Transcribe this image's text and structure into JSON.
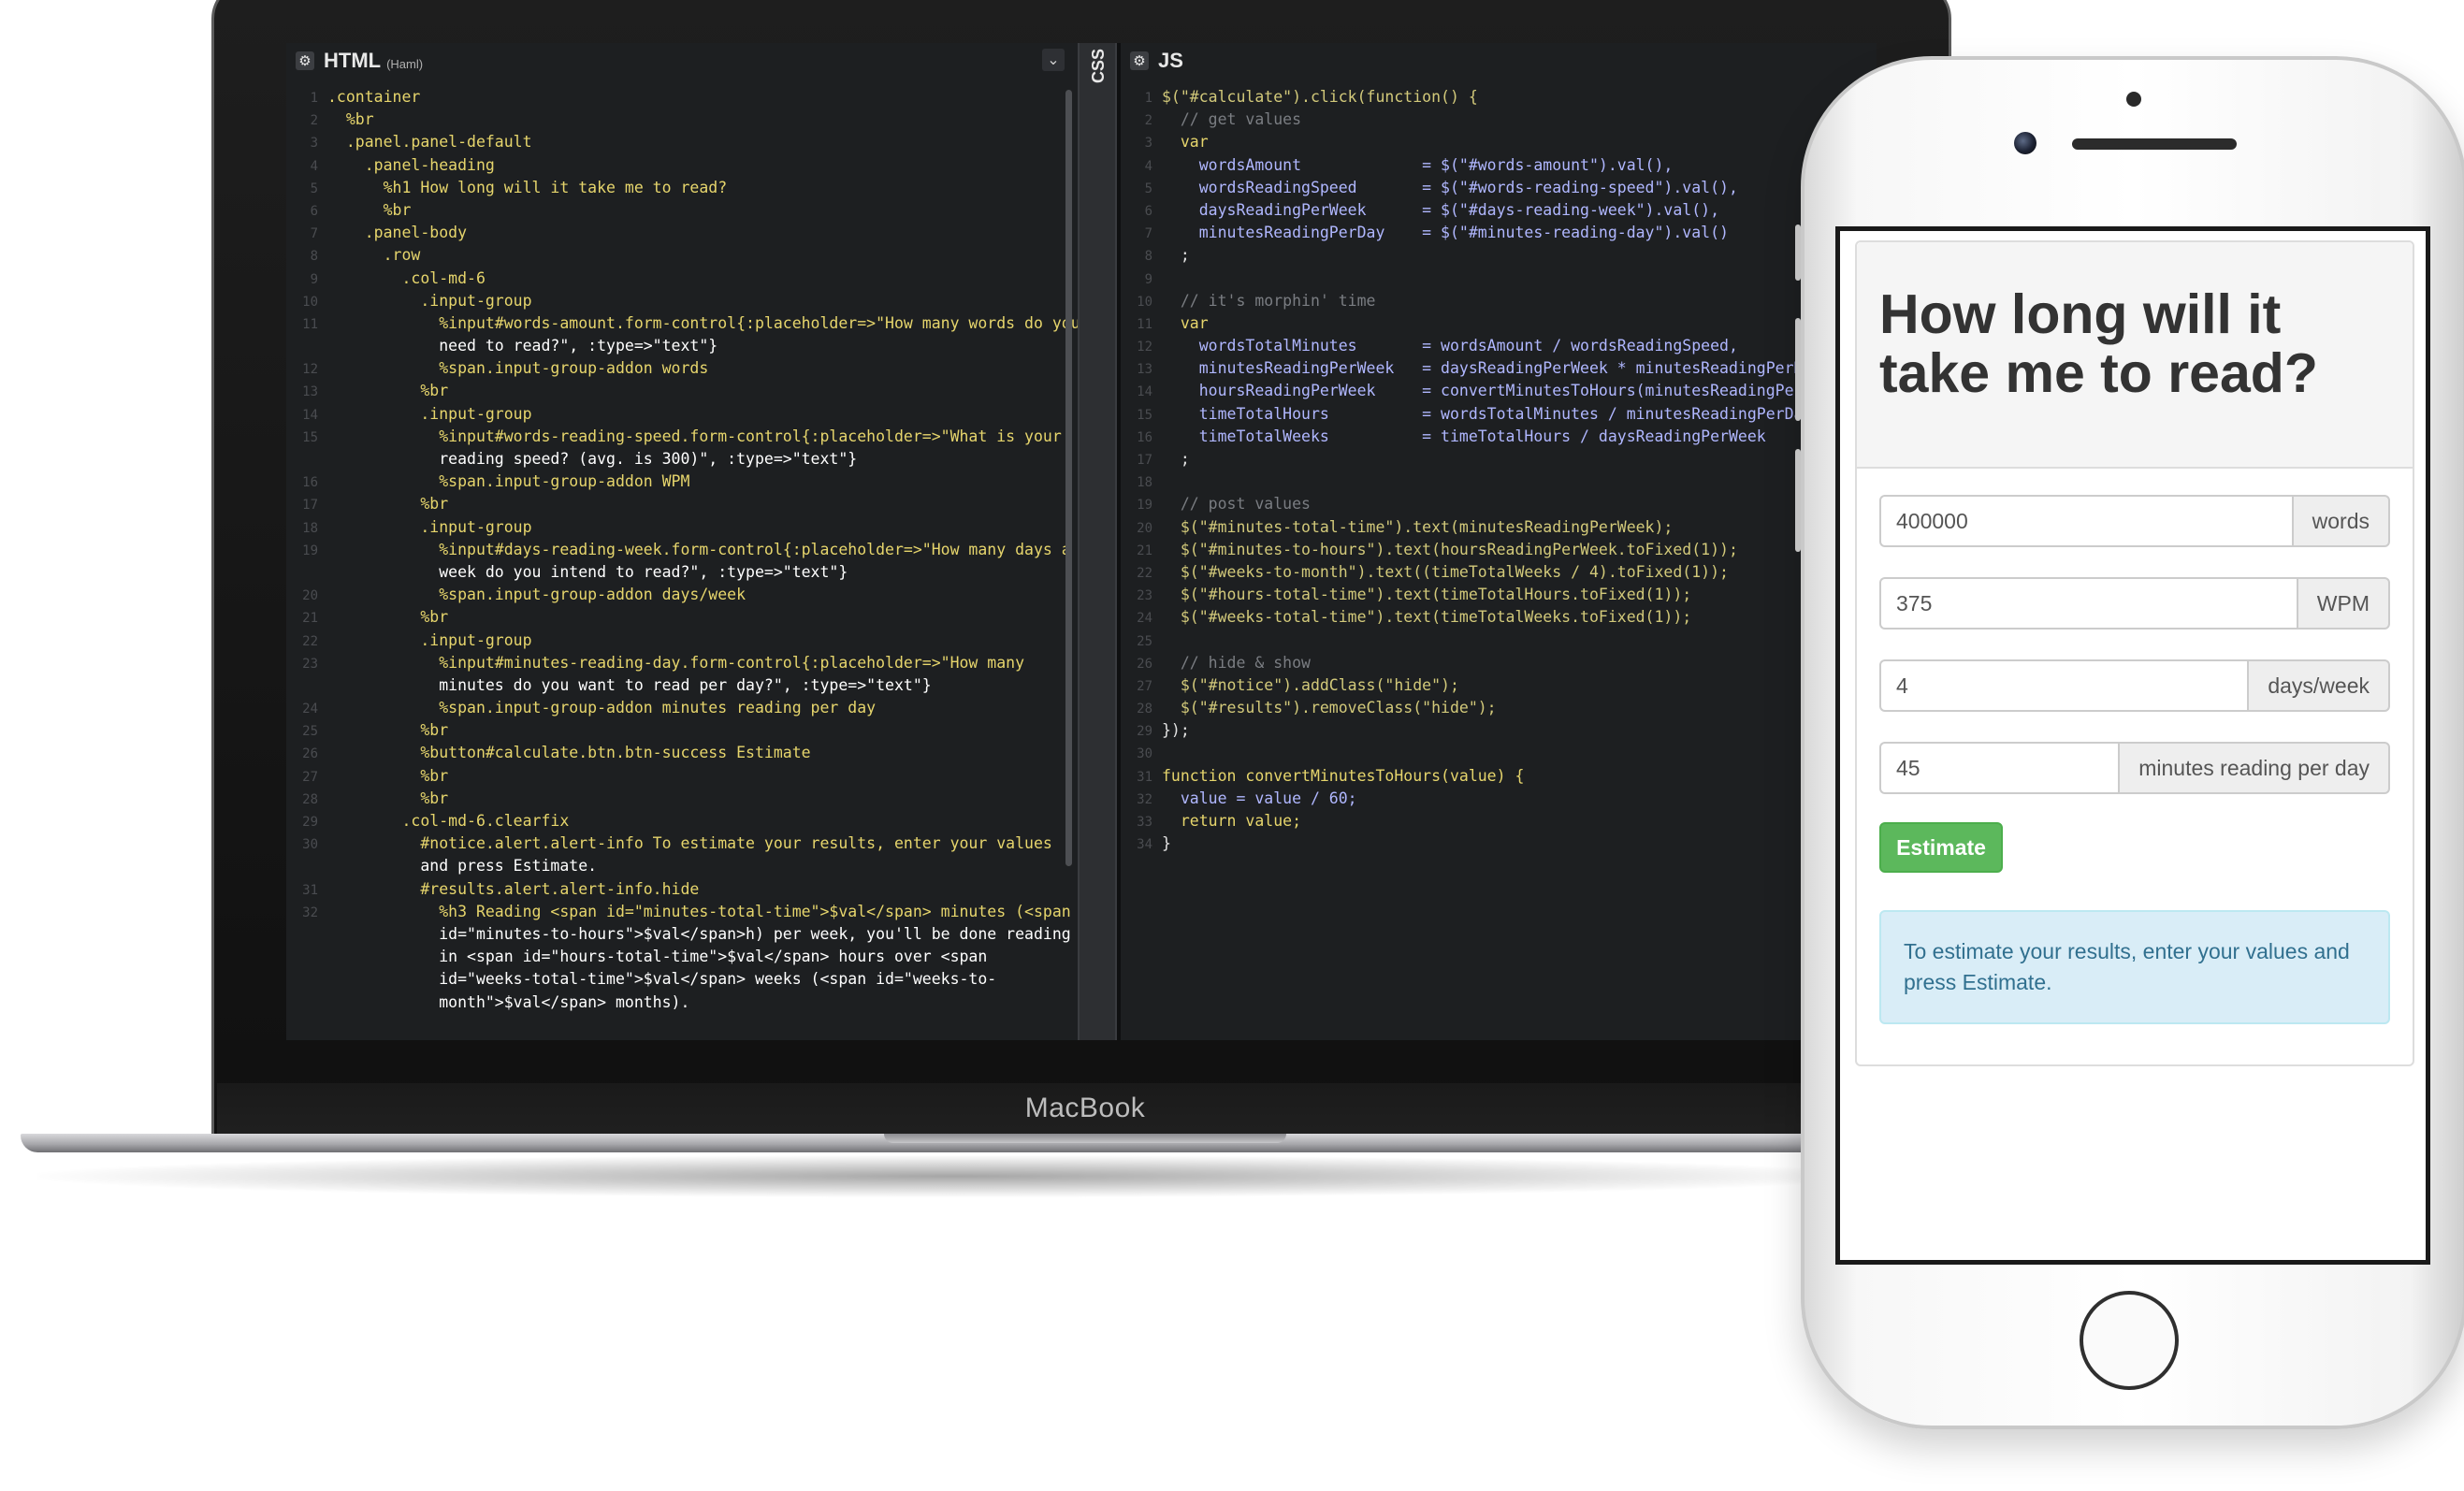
{
  "laptop": {
    "brand_label": "MacBook"
  },
  "editor": {
    "html_panel": {
      "title": "HTML",
      "subtitle": "(Haml)"
    },
    "css_panel": {
      "title": "CSS"
    },
    "js_panel": {
      "title": "JS"
    },
    "html_lines": [
      {
        "n": "1",
        "t": ".container"
      },
      {
        "n": "2",
        "t": "  %br"
      },
      {
        "n": "3",
        "t": "  .panel.panel-default"
      },
      {
        "n": "4",
        "t": "    .panel-heading"
      },
      {
        "n": "5",
        "t": "      %h1 How long will it take me to read?"
      },
      {
        "n": "6",
        "t": "      %br"
      },
      {
        "n": "7",
        "t": "    .panel-body"
      },
      {
        "n": "8",
        "t": "      .row"
      },
      {
        "n": "9",
        "t": "        .col-md-6"
      },
      {
        "n": "10",
        "t": "          .input-group"
      },
      {
        "n": "11",
        "t": "            %input#words-amount.form-control{:placeholder=>\"How many words do you"
      },
      {
        "n": "",
        "t": "            need to read?\", :type=>\"text\"}"
      },
      {
        "n": "12",
        "t": "            %span.input-group-addon words"
      },
      {
        "n": "13",
        "t": "          %br"
      },
      {
        "n": "14",
        "t": "          .input-group"
      },
      {
        "n": "15",
        "t": "            %input#words-reading-speed.form-control{:placeholder=>\"What is your"
      },
      {
        "n": "",
        "t": "            reading speed? (avg. is 300)\", :type=>\"text\"}"
      },
      {
        "n": "16",
        "t": "            %span.input-group-addon WPM"
      },
      {
        "n": "17",
        "t": "          %br"
      },
      {
        "n": "18",
        "t": "          .input-group"
      },
      {
        "n": "19",
        "t": "            %input#days-reading-week.form-control{:placeholder=>\"How many days a"
      },
      {
        "n": "",
        "t": "            week do you intend to read?\", :type=>\"text\"}"
      },
      {
        "n": "20",
        "t": "            %span.input-group-addon days/week"
      },
      {
        "n": "21",
        "t": "          %br"
      },
      {
        "n": "22",
        "t": "          .input-group"
      },
      {
        "n": "23",
        "t": "            %input#minutes-reading-day.form-control{:placeholder=>\"How many"
      },
      {
        "n": "",
        "t": "            minutes do you want to read per day?\", :type=>\"text\"}"
      },
      {
        "n": "24",
        "t": "            %span.input-group-addon minutes reading per day"
      },
      {
        "n": "25",
        "t": "          %br"
      },
      {
        "n": "26",
        "t": "          %button#calculate.btn.btn-success Estimate"
      },
      {
        "n": "27",
        "t": "          %br"
      },
      {
        "n": "28",
        "t": "          %br"
      },
      {
        "n": "29",
        "t": "        .col-md-6.clearfix"
      },
      {
        "n": "30",
        "t": "          #notice.alert.alert-info To estimate your results, enter your values"
      },
      {
        "n": "",
        "t": "          and press Estimate."
      },
      {
        "n": "31",
        "t": "          #results.alert.alert-info.hide"
      },
      {
        "n": "32",
        "t": "            %h3 Reading <span id=\"minutes-total-time\">$val</span> minutes (<span"
      },
      {
        "n": "",
        "t": "            id=\"minutes-to-hours\">$val</span>h) per week, you'll be done reading"
      },
      {
        "n": "",
        "t": "            in <span id=\"hours-total-time\">$val</span> hours over <span"
      },
      {
        "n": "",
        "t": "            id=\"weeks-total-time\">$val</span> weeks (<span id=\"weeks-to-"
      },
      {
        "n": "",
        "t": "            month\">$val</span> months)."
      }
    ],
    "js_lines": [
      {
        "n": "1",
        "t": "$(\"#calculate\").click(function() {"
      },
      {
        "n": "2",
        "t": "  // get values"
      },
      {
        "n": "3",
        "t": "  var"
      },
      {
        "n": "4",
        "t": "    wordsAmount             = $(\"#words-amount\").val(),"
      },
      {
        "n": "5",
        "t": "    wordsReadingSpeed       = $(\"#words-reading-speed\").val(),"
      },
      {
        "n": "6",
        "t": "    daysReadingPerWeek      = $(\"#days-reading-week\").val(),"
      },
      {
        "n": "7",
        "t": "    minutesReadingPerDay    = $(\"#minutes-reading-day\").val()"
      },
      {
        "n": "8",
        "t": "  ;"
      },
      {
        "n": "9",
        "t": ""
      },
      {
        "n": "10",
        "t": "  // it's morphin' time"
      },
      {
        "n": "11",
        "t": "  var"
      },
      {
        "n": "12",
        "t": "    wordsTotalMinutes       = wordsAmount / wordsReadingSpeed,"
      },
      {
        "n": "13",
        "t": "    minutesReadingPerWeek   = daysReadingPerWeek * minutesReadingPerDa"
      },
      {
        "n": "14",
        "t": "    hoursReadingPerWeek     = convertMinutesToHours(minutesReadingPerW"
      },
      {
        "n": "15",
        "t": "    timeTotalHours          = wordsTotalMinutes / minutesReadingPerDay"
      },
      {
        "n": "16",
        "t": "    timeTotalWeeks          = timeTotalHours / daysReadingPerWeek"
      },
      {
        "n": "17",
        "t": "  ;"
      },
      {
        "n": "18",
        "t": ""
      },
      {
        "n": "19",
        "t": "  // post values"
      },
      {
        "n": "20",
        "t": "  $(\"#minutes-total-time\").text(minutesReadingPerWeek);"
      },
      {
        "n": "21",
        "t": "  $(\"#minutes-to-hours\").text(hoursReadingPerWeek.toFixed(1));"
      },
      {
        "n": "22",
        "t": "  $(\"#weeks-to-month\").text((timeTotalWeeks / 4).toFixed(1));"
      },
      {
        "n": "23",
        "t": "  $(\"#hours-total-time\").text(timeTotalHours.toFixed(1));"
      },
      {
        "n": "24",
        "t": "  $(\"#weeks-total-time\").text(timeTotalWeeks.toFixed(1));"
      },
      {
        "n": "25",
        "t": ""
      },
      {
        "n": "26",
        "t": "  // hide & show"
      },
      {
        "n": "27",
        "t": "  $(\"#notice\").addClass(\"hide\");"
      },
      {
        "n": "28",
        "t": "  $(\"#results\").removeClass(\"hide\");"
      },
      {
        "n": "29",
        "t": "});"
      },
      {
        "n": "30",
        "t": ""
      },
      {
        "n": "31",
        "t": "function convertMinutesToHours(value) {"
      },
      {
        "n": "32",
        "t": "  value = value / 60;"
      },
      {
        "n": "33",
        "t": "  return value;"
      },
      {
        "n": "34",
        "t": "}"
      }
    ]
  },
  "phone_app": {
    "heading": "How long will it take me to read?",
    "inputs": [
      {
        "value": "400000",
        "addon": "words"
      },
      {
        "value": "375",
        "addon": "WPM"
      },
      {
        "value": "4",
        "addon": "days/week"
      },
      {
        "value": "45",
        "addon": "minutes reading per day"
      }
    ],
    "estimate_label": "Estimate",
    "notice": "To estimate your results, enter your values and press Estimate."
  },
  "colors": {
    "editor_bg": "#1d1f21",
    "haml_selector": "#e6d56c",
    "haml_tag": "#e6d56c",
    "haml_attr": "#9fd46a",
    "js_string": "#d2c97a",
    "js_keyword": "#e6d56c",
    "js_comment": "#7a7d82",
    "js_var": "#b0b7ff",
    "js_number": "#e07b3c",
    "success": "#5cb85c",
    "info_bg": "#d9edf7",
    "info_text": "#31708f"
  }
}
